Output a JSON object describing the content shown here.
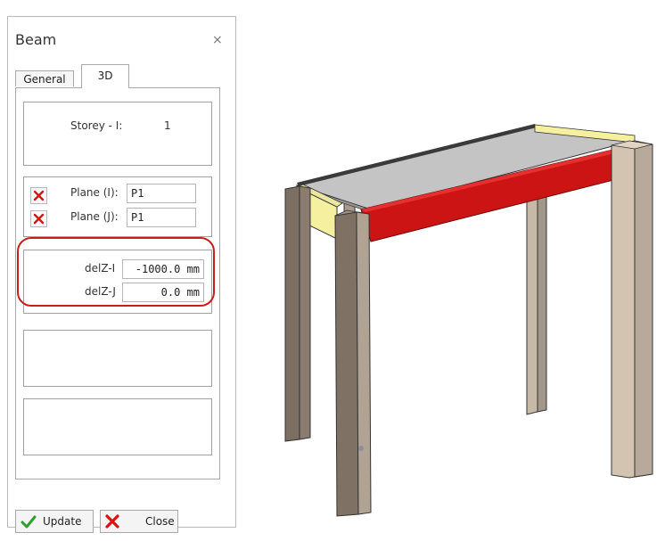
{
  "dialog": {
    "title": "Beam",
    "close_glyph": "×",
    "tabs": [
      {
        "label": "General",
        "active": false
      },
      {
        "label": "3D",
        "active": true
      }
    ],
    "storey": {
      "label": "Storey - I:",
      "value": "1"
    },
    "planes": [
      {
        "label": "Plane (I):",
        "value": "P1",
        "icon": "red-x-icon"
      },
      {
        "label": "Plane (J):",
        "value": "P1",
        "icon": "red-x-icon"
      }
    ],
    "offsets": [
      {
        "label": "delZ-I",
        "value": "-1000.0 mm"
      },
      {
        "label": "delZ-J",
        "value": "0.0 mm"
      }
    ],
    "buttons": {
      "update": {
        "label": "Update",
        "icon": "green-check-icon"
      },
      "close": {
        "label": "Close",
        "icon": "red-x-icon"
      }
    }
  },
  "colors": {
    "highlight_beam": "#cc1414",
    "highlight_ring": "#c81e1e",
    "column": "#b8aa9a",
    "end_beam": "#f4f0a0",
    "slab": "#c4c4c4"
  }
}
